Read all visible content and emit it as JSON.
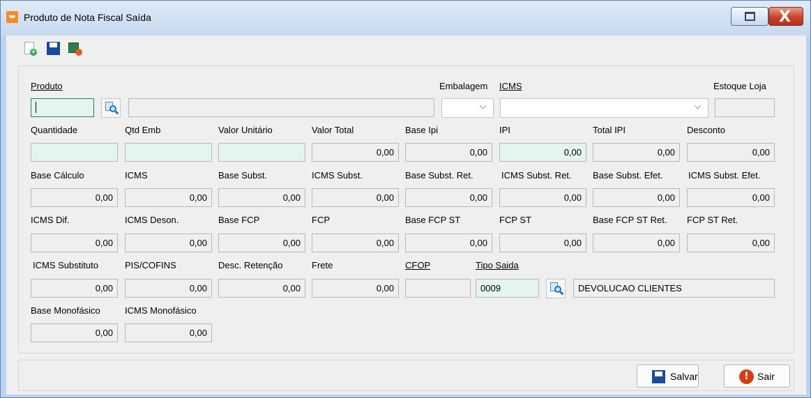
{
  "window": {
    "title": "Produto de Nota Fiscal Saída",
    "close_glyph": "X"
  },
  "toolbar": {
    "icons": [
      "new-document-icon",
      "save-icon",
      "exit-icon"
    ]
  },
  "labels": {
    "produto": "Produto",
    "embalagem": "Embalagem",
    "icms_combo": "ICMS",
    "estoque_loja": "Estoque Loja",
    "quantidade": "Quantidade",
    "qtd_emb": "Qtd Emb",
    "valor_unitario": "Valor Unitário",
    "valor_total": "Valor Total",
    "base_ipi": "Base Ipi",
    "ipi": "IPI",
    "total_ipi": "Total IPI",
    "desconto": "Desconto",
    "base_calculo": "Base Cálculo",
    "icms": "ICMS",
    "base_subst": "Base Subst.",
    "icms_subst": "ICMS Subst.",
    "base_subst_ret": "Base Subst. Ret.",
    "icms_subst_ret": "ICMS Subst. Ret.",
    "base_subst_efet": "Base Subst. Efet.",
    "icms_subst_efet": "ICMS Subst. Efet.",
    "icms_dif": "ICMS Dif.",
    "icms_deson": "ICMS Deson.",
    "base_fcp": "Base FCP",
    "fcp": "FCP",
    "base_fcp_st": "Base FCP ST",
    "fcp_st": "FCP ST",
    "base_fcp_st_ret": "Base FCP ST Ret.",
    "fcp_st_ret": "FCP ST Ret.",
    "icms_substituto": "ICMS Substituto",
    "pis_cofins": "PIS/COFINS",
    "desc_retencao": "Desc. Retenção",
    "frete": "Frete",
    "cfop": "CFOP",
    "tipo_saida": "Tipo Saida",
    "base_monofasico": "Base Monofásico",
    "icms_monofasico": "ICMS Monofásico"
  },
  "values": {
    "produto_code": "",
    "produto_desc": "",
    "embalagem": "",
    "icms_combo": "",
    "estoque_loja": "",
    "quantidade": "",
    "qtd_emb": "",
    "valor_unitario": "",
    "valor_total": "0,00",
    "base_ipi": "0,00",
    "ipi": "0,00",
    "total_ipi": "0,00",
    "desconto": "0,00",
    "base_calculo": "0,00",
    "icms": "0,00",
    "base_subst": "0,00",
    "icms_subst": "0,00",
    "base_subst_ret": "0,00",
    "icms_subst_ret": "0,00",
    "base_subst_efet": "0,00",
    "icms_subst_efet": "0,00",
    "icms_dif": "0,00",
    "icms_deson": "0,00",
    "base_fcp": "0,00",
    "fcp": "0,00",
    "base_fcp_st": "0,00",
    "fcp_st": "0,00",
    "base_fcp_st_ret": "0,00",
    "fcp_st_ret": "0,00",
    "icms_substituto": "0,00",
    "pis_cofins": "0,00",
    "desc_retencao": "0,00",
    "frete": "0,00",
    "cfop": "",
    "tipo_saida_code": "0009",
    "tipo_saida_desc": "DEVOLUCAO CLIENTES",
    "base_monofasico": "0,00",
    "icms_monofasico": "0,00"
  },
  "buttons": {
    "salvar": "Salvar",
    "sair": "Sair",
    "stop_glyph": "!"
  }
}
